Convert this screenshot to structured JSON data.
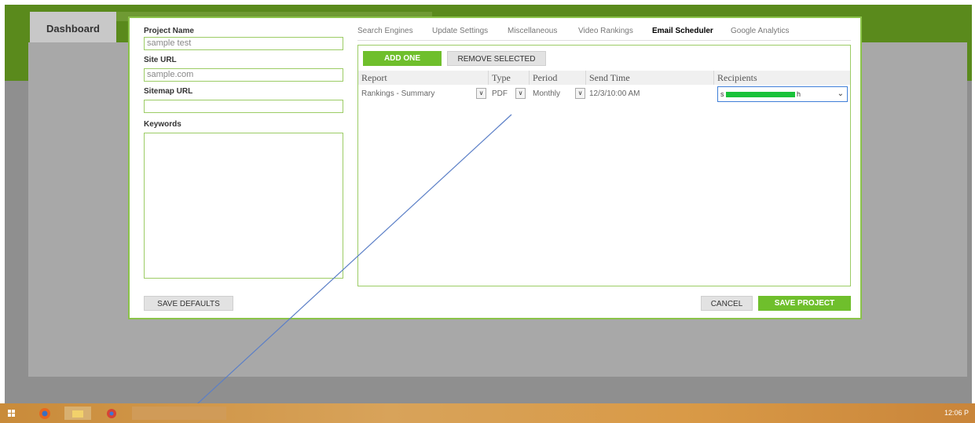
{
  "app": {
    "dashboard_tab": "Dashboard"
  },
  "form": {
    "project_name_label": "Project Name",
    "project_name_value": "sample test",
    "site_url_label": "Site URL",
    "site_url_placeholder": "sample.com",
    "sitemap_url_label": "Sitemap URL",
    "sitemap_url_value": "",
    "keywords_label": "Keywords"
  },
  "tabs": [
    {
      "label": "Search Engines"
    },
    {
      "label": "Update Settings"
    },
    {
      "label": "Miscellaneous"
    },
    {
      "label": "Video Rankings"
    },
    {
      "label": "Email Scheduler",
      "active": true
    },
    {
      "label": "Google Analytics"
    }
  ],
  "scheduler": {
    "add_button": "ADD ONE",
    "remove_button": "REMOVE SELECTED",
    "columns": [
      "Report",
      "Type",
      "Period",
      "Send Time",
      "Recipients"
    ],
    "rows": [
      {
        "report": "Rankings - Summary",
        "type": "PDF",
        "period": "Monthly",
        "send_time": "12/3/10:00 AM",
        "recipient_visible": "s",
        "recipient_tail": "h"
      }
    ]
  },
  "footer": {
    "save_defaults": "SAVE DEFAULTS",
    "cancel": "CANCEL",
    "save_project": "SAVE PROJECT"
  },
  "taskbar": {
    "clock": "12:06 P"
  },
  "icons": {
    "dropdown": "chevron-down-icon",
    "start": "windows-start-icon",
    "browser": "firefox-icon",
    "explorer": "file-explorer-icon",
    "chrome": "chrome-icon"
  },
  "colors": {
    "accent": "#6fbf2c",
    "header": "#5a8a1c",
    "mask": "#19c23a"
  }
}
